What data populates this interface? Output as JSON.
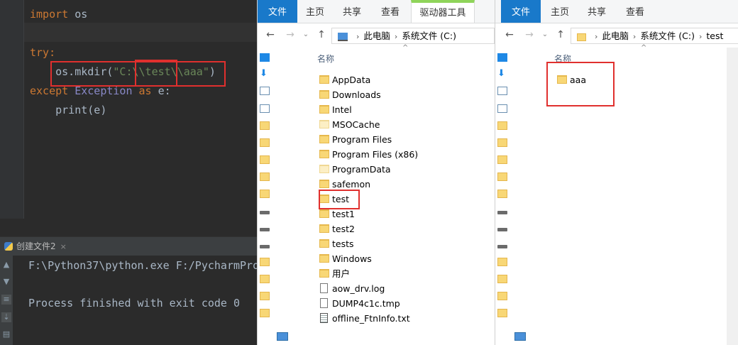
{
  "ide": {
    "code_lines": {
      "l1_kw": "import",
      "l1_rest": " os",
      "l3": "try:",
      "l4_prefix": "    os.mkdir(",
      "l4_str": "\"C:\\\\test\\\\aaa\"",
      "l4_suffix": ")",
      "l5_except": "except",
      "l5_cls": " Exception",
      "l5_as": " as",
      "l5_rest": " e:",
      "l6": "    print(e)"
    },
    "run_tab_label": "创建文件2",
    "run_tab_close": "×",
    "console": {
      "line1": "F:\\Python37\\python.exe F:/PycharmPro",
      "line3": "Process finished with exit code 0"
    }
  },
  "explorer1": {
    "tabs": [
      "文件",
      "主页",
      "共享",
      "查看",
      "驱动器工具"
    ],
    "breadcrumb": [
      "此电脑",
      "系统文件 (C:)"
    ],
    "column_name": "名称",
    "items": [
      {
        "name": "AppData",
        "type": "folder"
      },
      {
        "name": "Downloads",
        "type": "folder"
      },
      {
        "name": "Intel",
        "type": "folder"
      },
      {
        "name": "MSOCache",
        "type": "folder-faded"
      },
      {
        "name": "Program Files",
        "type": "folder"
      },
      {
        "name": "Program Files (x86)",
        "type": "folder"
      },
      {
        "name": "ProgramData",
        "type": "folder-faded"
      },
      {
        "name": "safemon",
        "type": "folder"
      },
      {
        "name": "test",
        "type": "folder"
      },
      {
        "name": "test1",
        "type": "folder"
      },
      {
        "name": "test2",
        "type": "folder"
      },
      {
        "name": "tests",
        "type": "folder"
      },
      {
        "name": "Windows",
        "type": "folder"
      },
      {
        "name": "用户",
        "type": "folder"
      },
      {
        "name": "aow_drv.log",
        "type": "file"
      },
      {
        "name": "DUMP4c1c.tmp",
        "type": "file"
      },
      {
        "name": "offline_FtnInfo.txt",
        "type": "file-txt"
      }
    ]
  },
  "explorer2": {
    "tabs": [
      "文件",
      "主页",
      "共享",
      "查看"
    ],
    "breadcrumb": [
      "此电脑",
      "系统文件 (C:)",
      "test"
    ],
    "column_name": "名称",
    "items": [
      {
        "name": "aaa",
        "type": "folder"
      }
    ]
  },
  "colors": {
    "ide_bg": "#2b2b2b",
    "keyword": "#cc7832",
    "string": "#6a8759",
    "highlight_box": "#e0302e",
    "ribbon_file_tab": "#1979ca",
    "drive_tools_accent": "#8fd45a"
  }
}
